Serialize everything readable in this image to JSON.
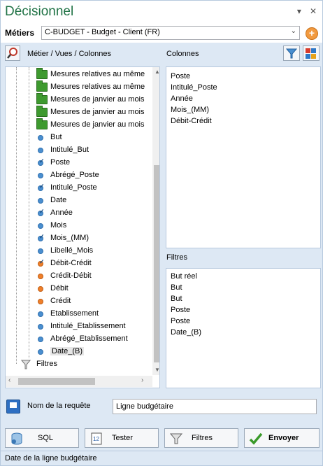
{
  "title": "Décisionnel",
  "titlebar": {
    "dropdown_glyph": "▾",
    "close_glyph": "✕"
  },
  "metiers": {
    "label": "Métiers",
    "selected": "C-BUDGET - Budget - Client (FR)",
    "add_glyph": "+"
  },
  "tree": {
    "header": "Métier / Vues / Colonnes",
    "folders": [
      "Mesures relatives au même",
      "Mesures relatives au même",
      "Mesures de janvier au mois",
      "Mesures de janvier au mois",
      "Mesures de janvier au mois"
    ],
    "fields": [
      {
        "label": "But",
        "color": "blue",
        "checked": false
      },
      {
        "label": "Intitulé_But",
        "color": "blue",
        "checked": false
      },
      {
        "label": "Poste",
        "color": "blue",
        "checked": true
      },
      {
        "label": "Abrégé_Poste",
        "color": "blue",
        "checked": false
      },
      {
        "label": "Intitulé_Poste",
        "color": "blue",
        "checked": true
      },
      {
        "label": "Date",
        "color": "blue",
        "checked": false
      },
      {
        "label": "Année",
        "color": "blue",
        "checked": true
      },
      {
        "label": "Mois",
        "color": "blue",
        "checked": false
      },
      {
        "label": "Mois_(MM)",
        "color": "blue",
        "checked": true
      },
      {
        "label": "Libellé_Mois",
        "color": "blue",
        "checked": false
      },
      {
        "label": "Débit-Crédit",
        "color": "orange",
        "checked": true
      },
      {
        "label": "Crédit-Débit",
        "color": "orange",
        "checked": false
      },
      {
        "label": "Débit",
        "color": "orange",
        "checked": false
      },
      {
        "label": "Crédit",
        "color": "orange",
        "checked": false
      },
      {
        "label": "Etablissement",
        "color": "blue",
        "checked": false
      },
      {
        "label": "Intitulé_Etablissement",
        "color": "blue",
        "checked": false
      },
      {
        "label": "Abrégé_Etablissement",
        "color": "blue",
        "checked": false
      },
      {
        "label": "Date_(B)",
        "color": "blue",
        "checked": false
      }
    ],
    "filtres_node": "Filtres"
  },
  "colonnes": {
    "header": "Colonnes",
    "items": [
      "Poste",
      "Intitulé_Poste",
      "Année",
      "Mois_(MM)",
      "Débit-Crédit"
    ]
  },
  "filtres": {
    "header": "Filtres",
    "items": [
      "But réel",
      "But",
      "But",
      "Poste",
      "Poste",
      "Date_(B)"
    ]
  },
  "request": {
    "label": "Nom de la requête",
    "value": "Ligne budgétaire"
  },
  "buttons": {
    "sql": "SQL",
    "tester": "Tester",
    "filtres": "Filtres",
    "envoyer": "Envoyer"
  },
  "status": "Date de la ligne budgétaire",
  "colors": {
    "title": "#217346",
    "pane_bg": "#dde8f4",
    "accent_orange": "#f29a3f"
  }
}
